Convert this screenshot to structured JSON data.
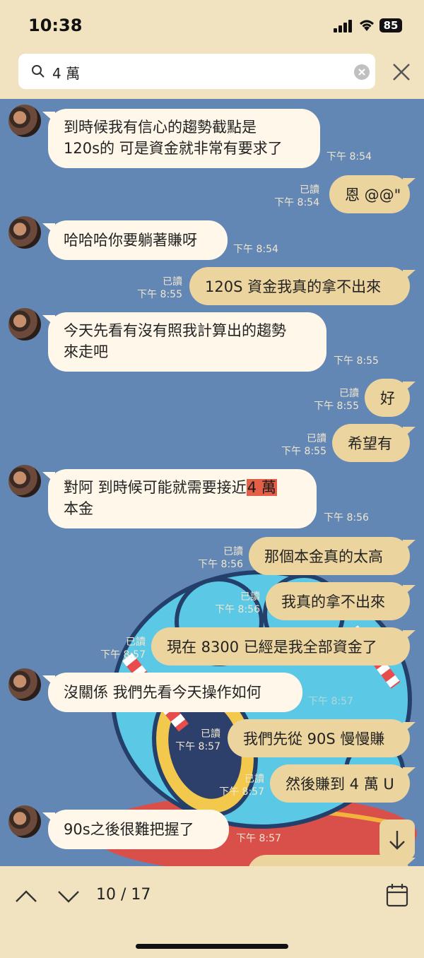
{
  "status": {
    "time": "10:38",
    "battery": "85"
  },
  "search": {
    "query": "4 萬"
  },
  "messages": [
    {
      "sender": "other",
      "lines": [
        "到時候我有信心的趨勢截點是",
        "120s的 可是資金就非常有要求了"
      ],
      "time": "下午 8:54"
    },
    {
      "sender": "me",
      "text": "恩 @@\"",
      "read": "已讀",
      "time": "下午 8:54"
    },
    {
      "sender": "other",
      "text": "哈哈哈你要躺著賺呀",
      "time": "下午 8:54"
    },
    {
      "sender": "me",
      "text": "120S 資金我真的拿不出來",
      "read": "已讀",
      "time": "下午 8:55"
    },
    {
      "sender": "other",
      "lines": [
        "今天先看有沒有照我計算出的趨勢",
        "來走吧"
      ],
      "time": "下午 8:55"
    },
    {
      "sender": "me",
      "text": "好",
      "read": "已讀",
      "time": "下午 8:55"
    },
    {
      "sender": "me",
      "text": "希望有",
      "read": "已讀",
      "time": "下午 8:55"
    },
    {
      "sender": "other",
      "pre": "對阿 到時候可能就需要接近",
      "highlight": "4 萬",
      "line2": "本金",
      "time": "下午 8:56"
    },
    {
      "sender": "me",
      "text": "那個本金真的太高",
      "read": "已讀",
      "time": "下午 8:56"
    },
    {
      "sender": "me",
      "text": "我真的拿不出來",
      "read": "已讀",
      "time": "下午 8:56"
    },
    {
      "sender": "me",
      "text": "現在 8300 已經是我全部資金了",
      "read": "已讀",
      "time": "下午 8:57"
    },
    {
      "sender": "other",
      "text": "沒關係 我們先看今天操作如何",
      "time": "下午 8:57"
    },
    {
      "sender": "me",
      "text": "我們先從 90S 慢慢賺",
      "read": "已讀",
      "time": "下午 8:57"
    },
    {
      "sender": "me",
      "text": "然後賺到 4 萬 U",
      "read": "已讀",
      "time": "下午 8:57"
    },
    {
      "sender": "other",
      "text": "90s之後很難把握了",
      "time": "下午 8:57"
    }
  ],
  "footer": {
    "counter": "10 / 17"
  },
  "icons": {
    "search": "magnifier-icon",
    "clear": "clear-icon",
    "close": "close-icon",
    "up": "chevron-up-icon",
    "down": "chevron-down-icon",
    "calendar": "calendar-icon",
    "scroll": "scroll-to-bottom-icon"
  },
  "colors": {
    "chat_bg": "#6387b4",
    "incoming": "#fff8ea",
    "outgoing": "#ecd49f",
    "highlight": "#e45f48",
    "header": "#f1e3c0"
  }
}
